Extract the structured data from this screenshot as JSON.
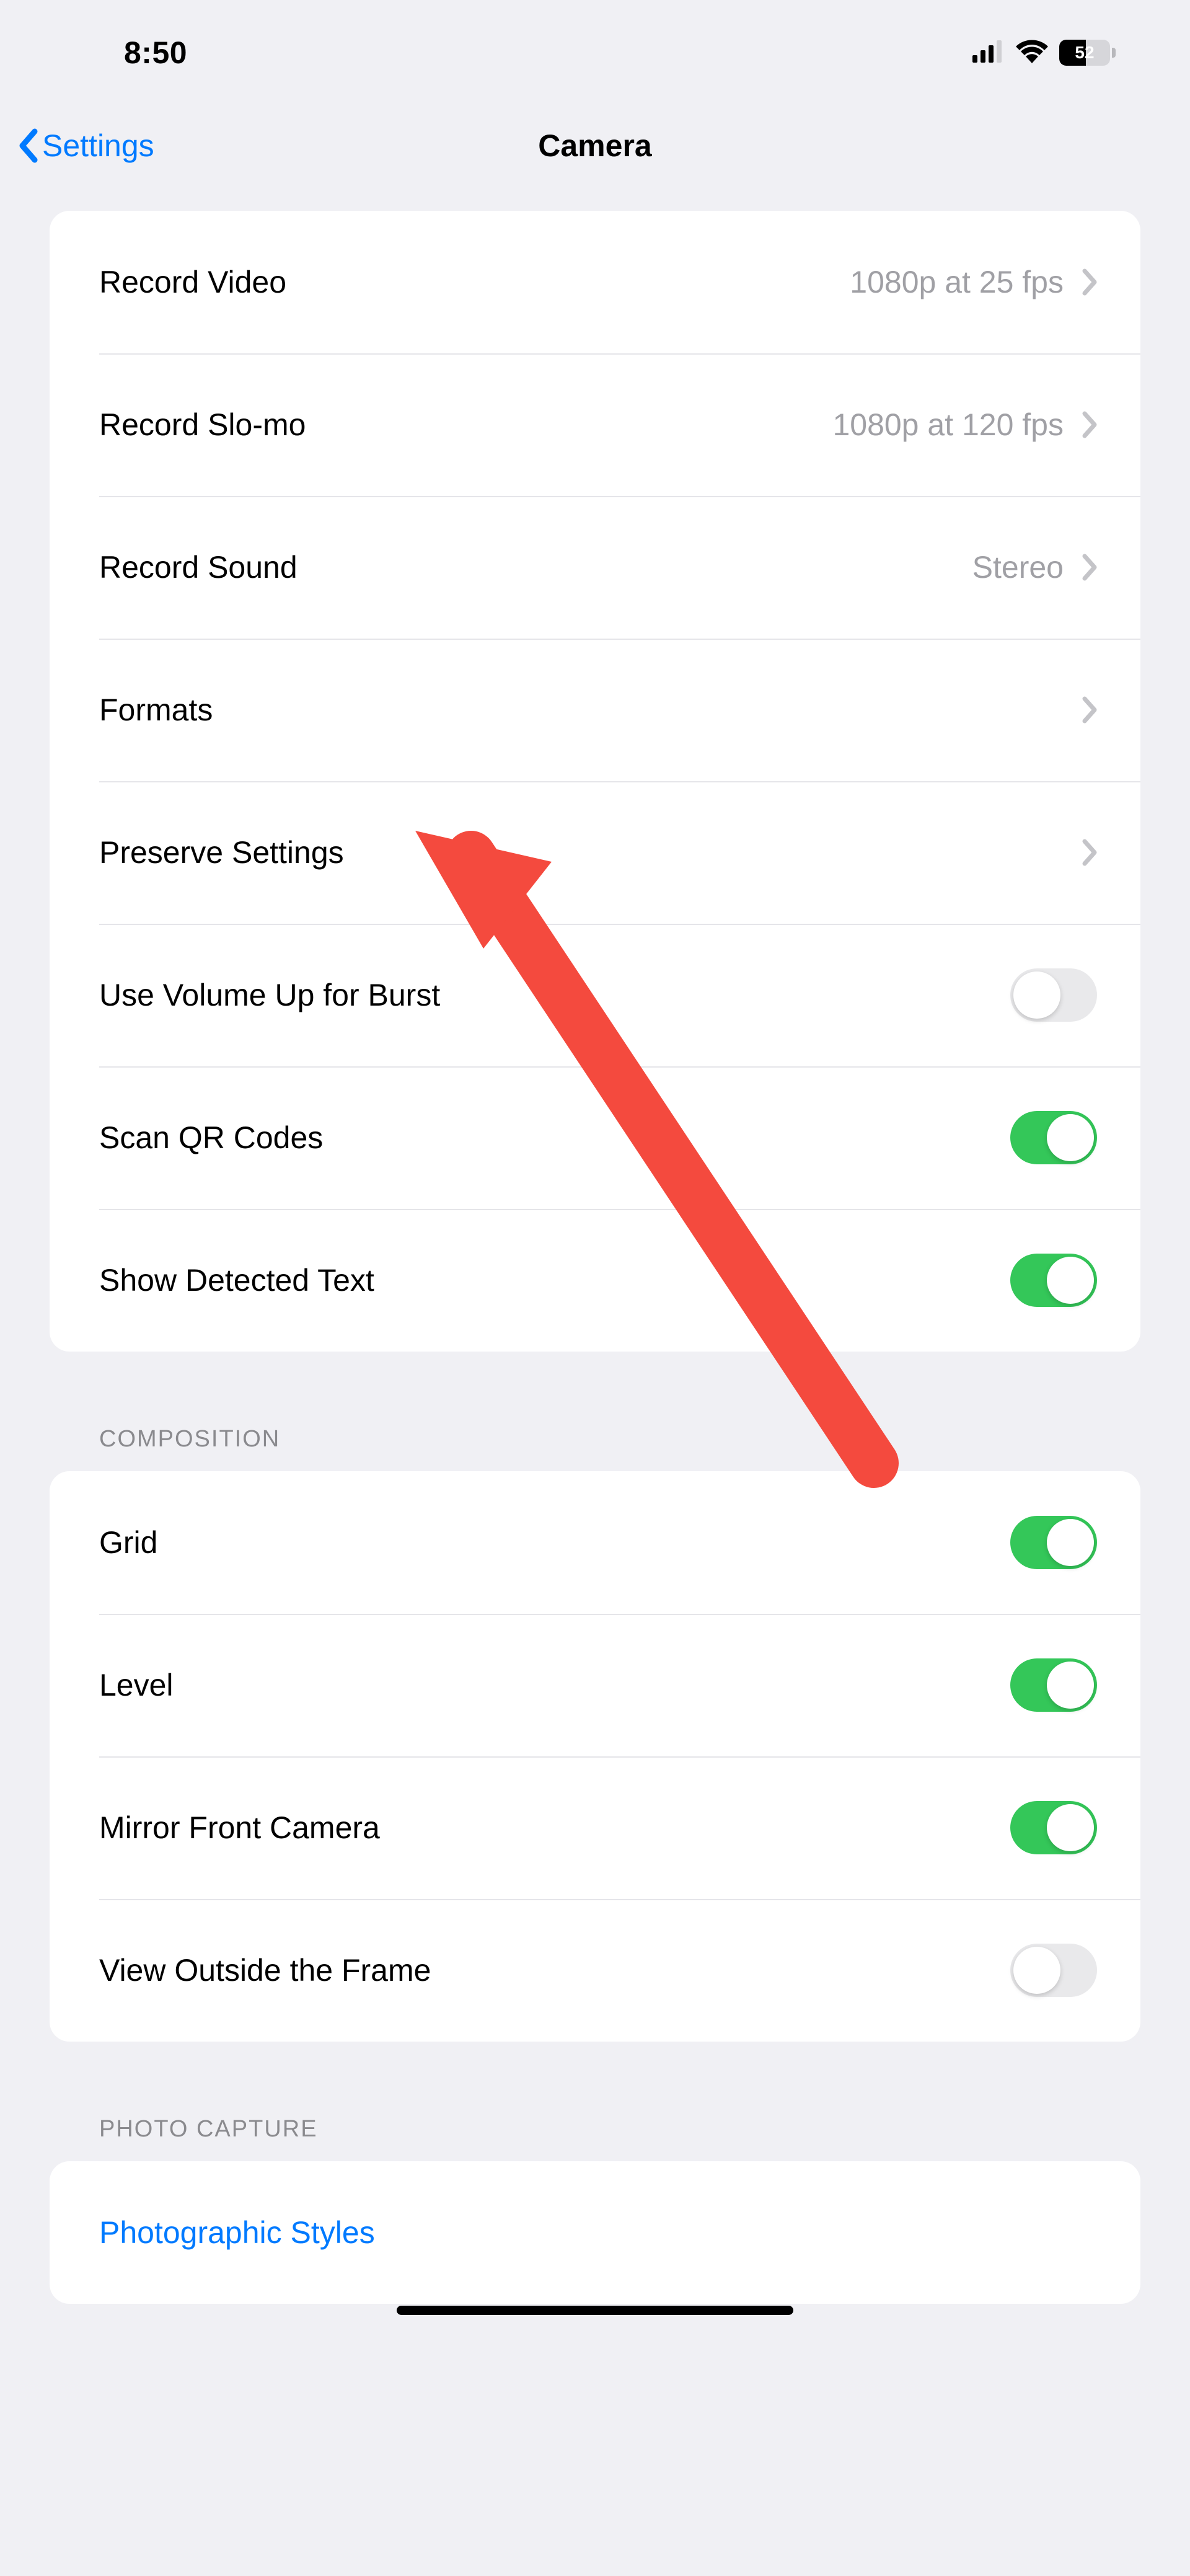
{
  "status": {
    "time": "8:50",
    "battery_pct": 52
  },
  "nav": {
    "back_label": "Settings",
    "title": "Camera"
  },
  "groups": [
    {
      "header": null,
      "rows": [
        {
          "id": "record-video",
          "type": "nav",
          "label": "Record Video",
          "value": "1080p at 25 fps"
        },
        {
          "id": "record-slomo",
          "type": "nav",
          "label": "Record Slo-mo",
          "value": "1080p at 120 fps"
        },
        {
          "id": "record-sound",
          "type": "nav",
          "label": "Record Sound",
          "value": "Stereo"
        },
        {
          "id": "formats",
          "type": "nav",
          "label": "Formats",
          "value": ""
        },
        {
          "id": "preserve-settings",
          "type": "nav",
          "label": "Preserve Settings",
          "value": ""
        },
        {
          "id": "volume-burst",
          "type": "toggle",
          "label": "Use Volume Up for Burst",
          "on": false
        },
        {
          "id": "scan-qr",
          "type": "toggle",
          "label": "Scan QR Codes",
          "on": true
        },
        {
          "id": "detected-text",
          "type": "toggle",
          "label": "Show Detected Text",
          "on": true
        }
      ]
    },
    {
      "header": "COMPOSITION",
      "rows": [
        {
          "id": "grid",
          "type": "toggle",
          "label": "Grid",
          "on": true
        },
        {
          "id": "level",
          "type": "toggle",
          "label": "Level",
          "on": true
        },
        {
          "id": "mirror-front",
          "type": "toggle",
          "label": "Mirror Front Camera",
          "on": true
        },
        {
          "id": "view-outside",
          "type": "toggle",
          "label": "View Outside the Frame",
          "on": false
        }
      ]
    },
    {
      "header": "PHOTO CAPTURE",
      "rows": [
        {
          "id": "photo-styles",
          "type": "link",
          "label": "Photographic Styles"
        }
      ]
    }
  ],
  "annotation": {
    "type": "arrow",
    "color": "#f44a3e",
    "points_to_row": "formats"
  }
}
